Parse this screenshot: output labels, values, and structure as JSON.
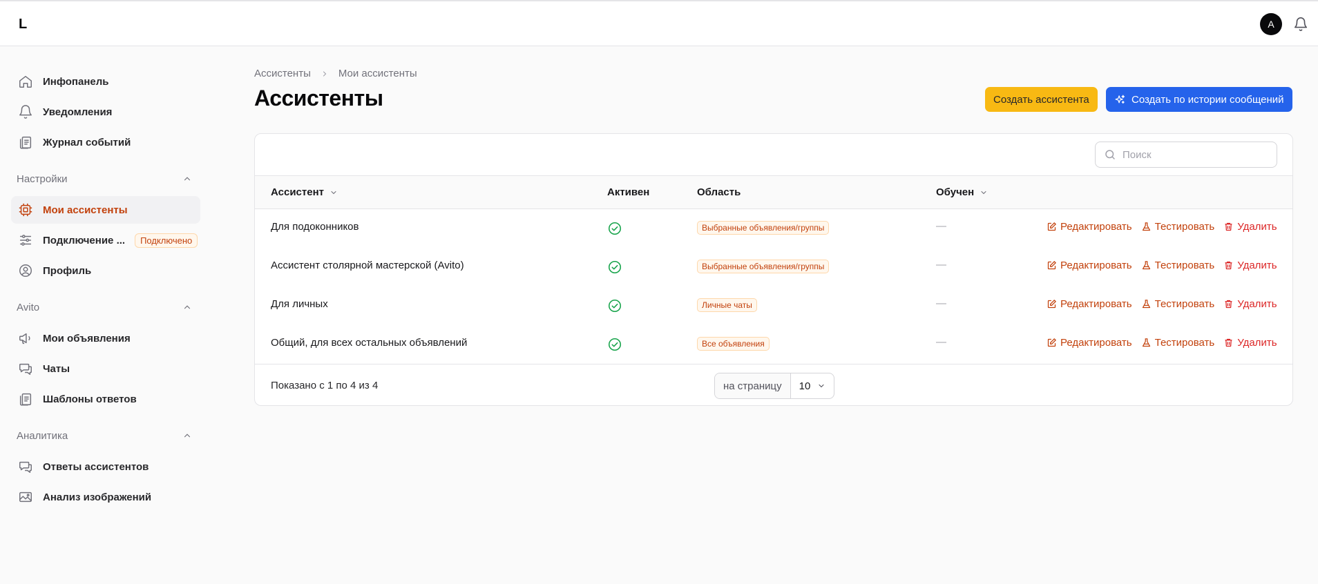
{
  "topbar": {
    "logo": "L",
    "avatar_letter": "A"
  },
  "sidebar": {
    "top_items": [
      {
        "label": "Инфопанель",
        "icon": "home-icon"
      },
      {
        "label": "Уведомления",
        "icon": "bell-icon"
      },
      {
        "label": "Журнал событий",
        "icon": "clipboard-icon"
      }
    ],
    "sections": [
      {
        "title": "Настройки",
        "items": [
          {
            "label": "Мои ассистенты",
            "icon": "chip-icon",
            "active": true
          },
          {
            "label": "Подключение ...",
            "icon": "sliders-icon",
            "badge": "Подключено"
          },
          {
            "label": "Профиль",
            "icon": "user-circle-icon"
          }
        ]
      },
      {
        "title": "Avito",
        "items": [
          {
            "label": "Мои объявления",
            "icon": "megaphone-icon"
          },
          {
            "label": "Чаты",
            "icon": "chat-icon"
          },
          {
            "label": "Шаблоны ответов",
            "icon": "clipboard-icon"
          }
        ]
      },
      {
        "title": "Аналитика",
        "items": [
          {
            "label": "Ответы ассистентов",
            "icon": "chat-icon"
          },
          {
            "label": "Анализ изображений",
            "icon": "image-icon"
          }
        ]
      }
    ]
  },
  "breadcrumb": {
    "parent": "Ассистенты",
    "current": "Мои ассистенты"
  },
  "page": {
    "title": "Ассистенты",
    "create_button": "Создать ассистента",
    "create_history_button": "Создать по истории сообщений"
  },
  "search": {
    "placeholder": "Поиск"
  },
  "table": {
    "headers": {
      "assistant": "Ассистент",
      "active": "Активен",
      "area": "Область",
      "trained": "Обучен"
    },
    "action_labels": {
      "edit": "Редактировать",
      "test": "Тестировать",
      "delete": "Удалить"
    },
    "rows": [
      {
        "name": "Для подоконников",
        "area": "Выбранные объявления/группы",
        "trained": "—"
      },
      {
        "name": "Ассистент столярной мастерской (Avito)",
        "area": "Выбранные объявления/группы",
        "trained": "—"
      },
      {
        "name": "Для личных",
        "area": "Личные чаты",
        "trained": "—"
      },
      {
        "name": "Общий, для всех остальных объявлений",
        "area": "Все объявления",
        "trained": "—"
      }
    ],
    "footer": {
      "shown": "Показано с 1 по 4 из 4",
      "per_page_label": "на страницу",
      "per_page_value": "10"
    }
  },
  "colors": {
    "accent": "#c2410c",
    "primary": "#2563eb",
    "yellow": "#f8b913",
    "success": "#16a34a",
    "danger": "#dc2626"
  }
}
